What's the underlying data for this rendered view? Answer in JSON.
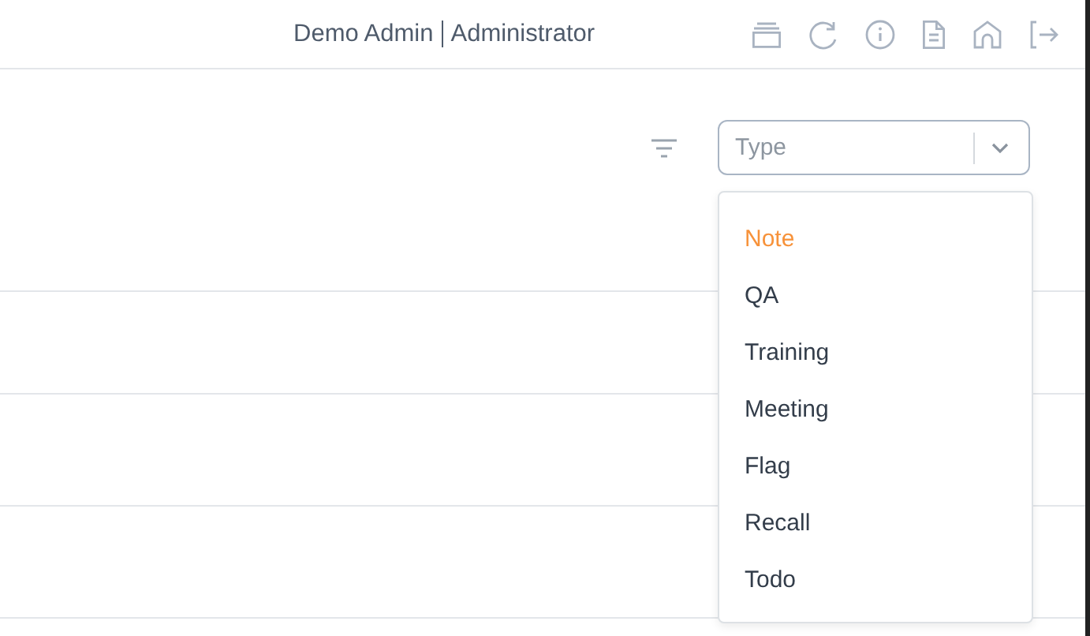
{
  "header": {
    "user": "Demo Admin",
    "role": "Administrator"
  },
  "type_select": {
    "placeholder": "Type",
    "expanded": true
  },
  "type_options": [
    {
      "label": "Note",
      "selected": true
    },
    {
      "label": "QA",
      "selected": false
    },
    {
      "label": "Training",
      "selected": false
    },
    {
      "label": "Meeting",
      "selected": false
    },
    {
      "label": "Flag",
      "selected": false
    },
    {
      "label": "Recall",
      "selected": false
    },
    {
      "label": "Todo",
      "selected": false
    }
  ]
}
